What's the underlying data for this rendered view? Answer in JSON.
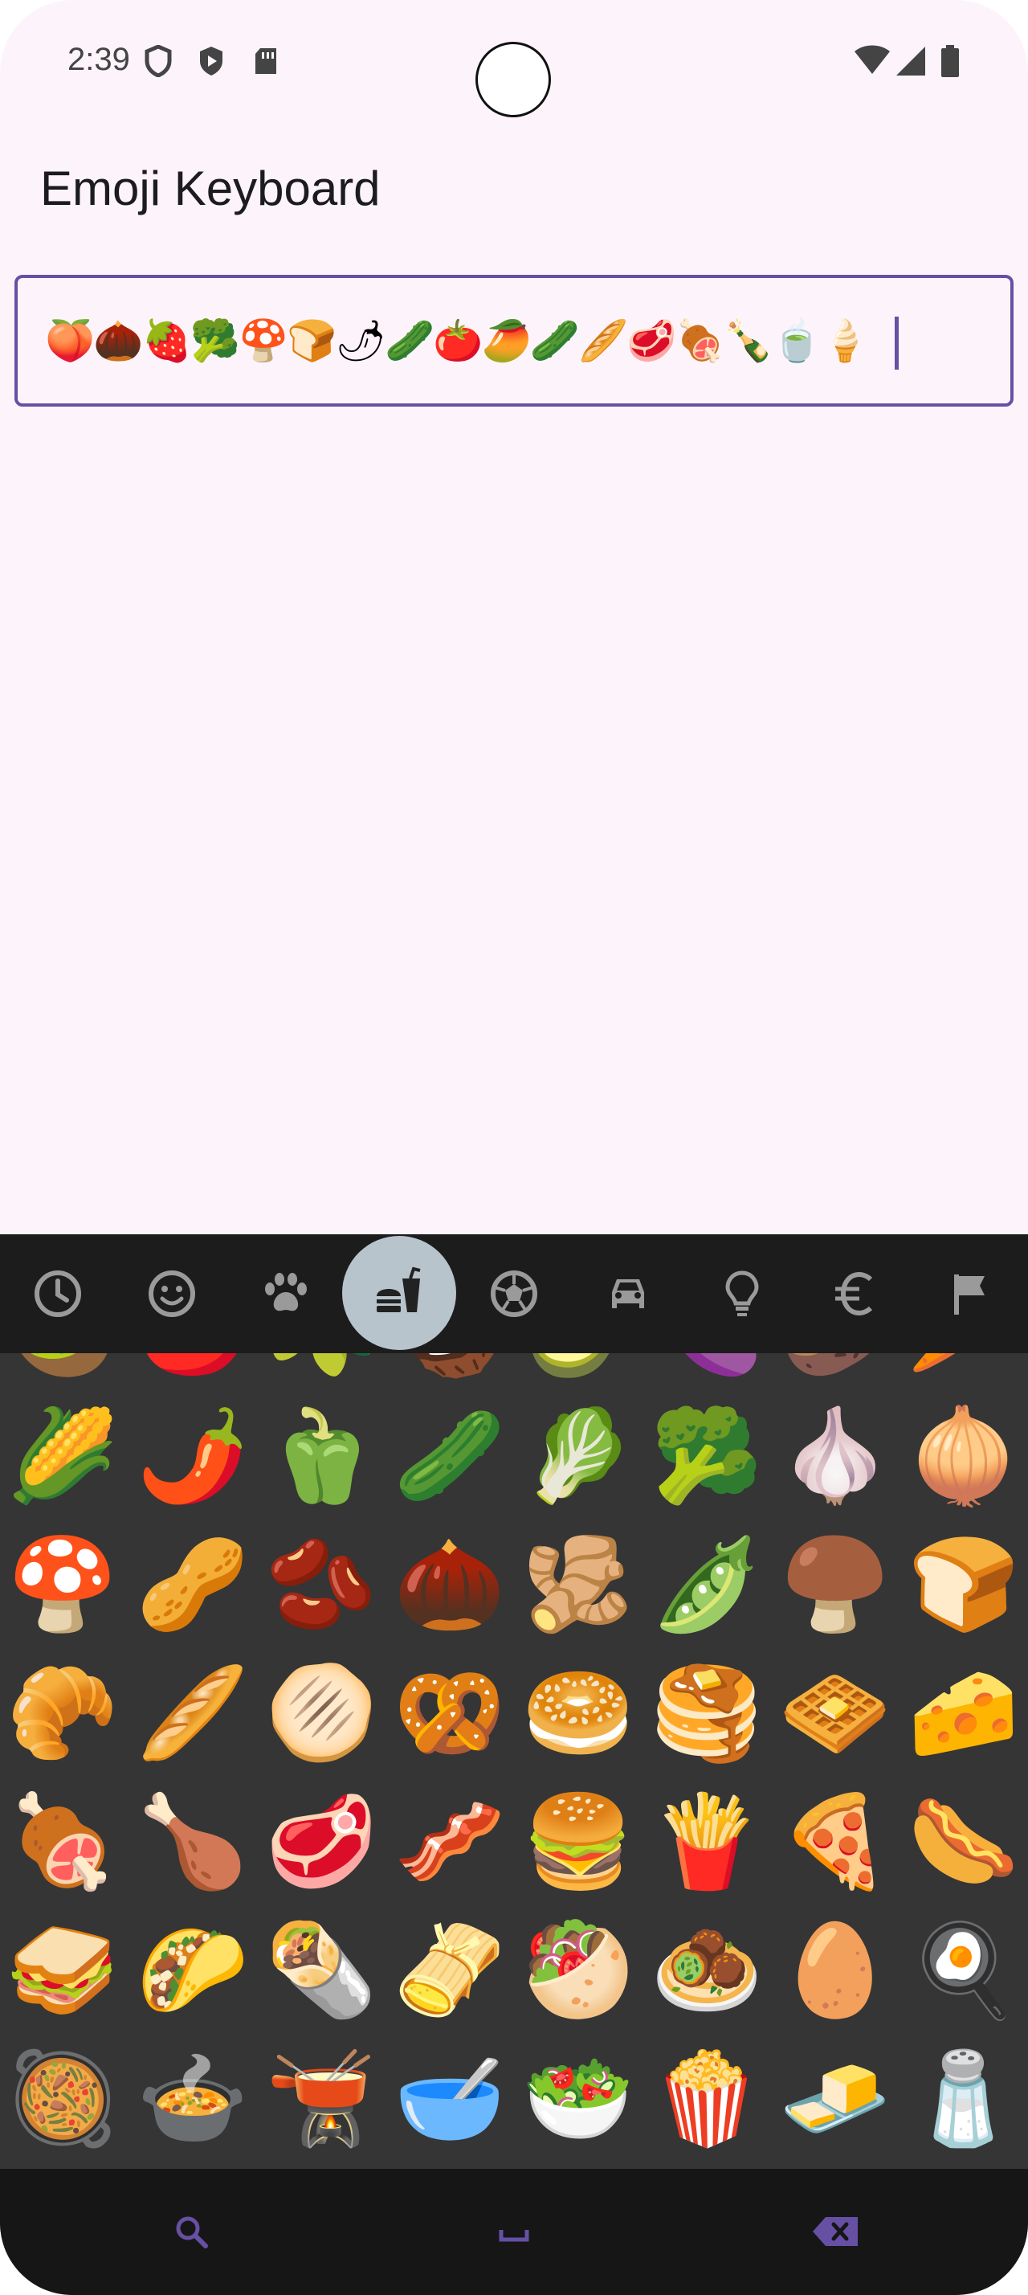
{
  "status_bar": {
    "time": "2:39"
  },
  "app": {
    "title": "Emoji Keyboard"
  },
  "text_field": {
    "value": "🍑🌰🍓🥦🍄🍞🌶🥒🍅🥭🥒🥖🥩🍖🍾🍵🍦"
  },
  "categories": [
    {
      "name": "recent-icon",
      "active": false
    },
    {
      "name": "smiley-icon",
      "active": false
    },
    {
      "name": "animals-icon",
      "active": false
    },
    {
      "name": "food-icon",
      "active": true
    },
    {
      "name": "activity-icon",
      "active": false
    },
    {
      "name": "travel-icon",
      "active": false
    },
    {
      "name": "objects-icon",
      "active": false
    },
    {
      "name": "symbols-icon",
      "active": false
    },
    {
      "name": "flags-icon",
      "active": false
    }
  ],
  "emoji_rows": [
    [
      "🥝",
      "🍅",
      "🫒",
      "🥥",
      "🥑",
      "🍆",
      "🥔",
      "🥕"
    ],
    [
      "🌽",
      "🌶️",
      "🫑",
      "🥒",
      "🥬",
      "🥦",
      "🧄",
      "🧅"
    ],
    [
      "🍄",
      "🥜",
      "🫘",
      "🌰",
      "🫚",
      "🫛",
      "🍄‍🟫",
      "🍞"
    ],
    [
      "🥐",
      "🥖",
      "🫓",
      "🥨",
      "🥯",
      "🥞",
      "🧇",
      "🧀"
    ],
    [
      "🍖",
      "🍗",
      "🥩",
      "🥓",
      "🍔",
      "🍟",
      "🍕",
      "🌭"
    ],
    [
      "🥪",
      "🌮",
      "🌯",
      "🫔",
      "🥙",
      "🧆",
      "🥚",
      "🍳"
    ],
    [
      "🥘",
      "🍲",
      "🫕",
      "🥣",
      "🥗",
      "🍿",
      "🧈",
      "🧂"
    ]
  ],
  "bottom_bar": {
    "search_icon": "search-icon",
    "space_icon": "space-icon",
    "backspace_icon": "backspace-icon"
  },
  "colors": {
    "accent": "#6750a4",
    "background": "#fdf4fb",
    "keyboard": "#353535"
  }
}
